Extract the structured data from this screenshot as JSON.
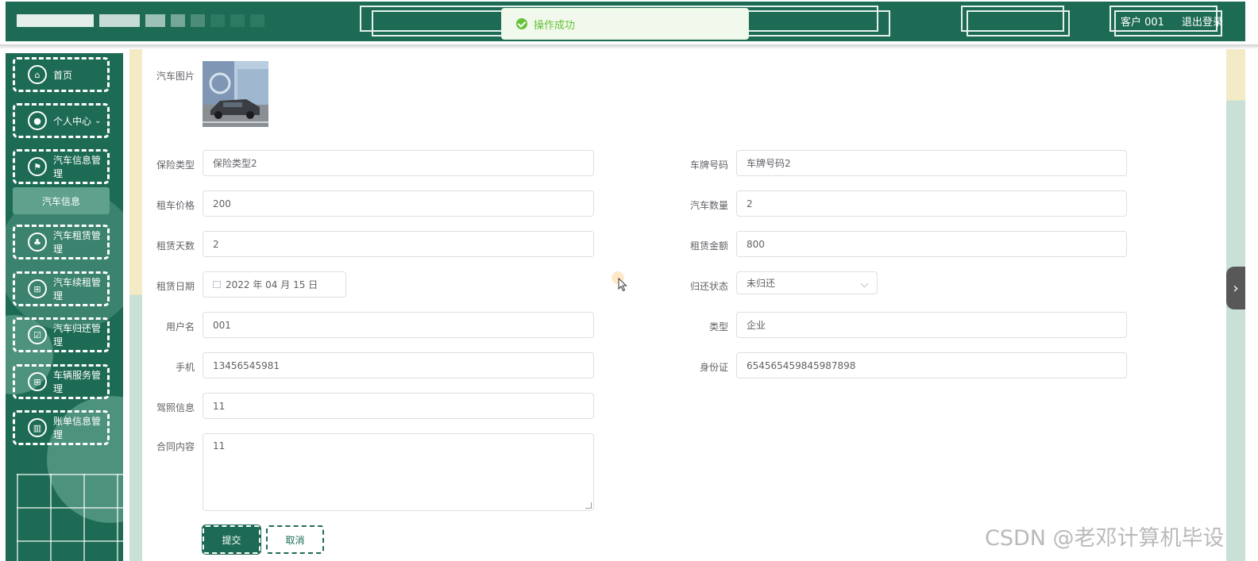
{
  "toast": {
    "message": "操作成功",
    "icon": "success-check-icon"
  },
  "header": {
    "user": "客户  001",
    "logout": "退出登录"
  },
  "sidebar": {
    "items": [
      {
        "label": "首页",
        "icon": "home-icon"
      },
      {
        "label": "个人中心",
        "icon": "user-icon",
        "chevron": "chevron-down-icon"
      },
      {
        "label": "汽车信息管理",
        "icon": "flag-icon"
      },
      {
        "label": "汽车租赁管理",
        "icon": "rental-icon"
      },
      {
        "label": "汽车续租管理",
        "icon": "grid-icon"
      },
      {
        "label": "汽车归还管理",
        "icon": "return-icon"
      },
      {
        "label": "车辆服务管理",
        "icon": "service-icon"
      },
      {
        "label": "账单信息管理",
        "icon": "chart-icon"
      }
    ],
    "submenu": {
      "label": "汽车信息"
    }
  },
  "form": {
    "image_label": "汽车图片",
    "insurance_type": {
      "label": "保险类型",
      "value": "保险类型2"
    },
    "plate_number": {
      "label": "车牌号码",
      "value": "车牌号码2"
    },
    "rental_price": {
      "label": "租车价格",
      "value": "200"
    },
    "car_count": {
      "label": "汽车数量",
      "value": "2"
    },
    "rental_days": {
      "label": "租赁天数",
      "value": "2"
    },
    "rental_amount": {
      "label": "租赁金额",
      "value": "800"
    },
    "rental_date": {
      "label": "租赁日期",
      "value": "2022 年 04 月 15 日"
    },
    "return_status": {
      "label": "归还状态",
      "value": "未归还"
    },
    "username": {
      "label": "用户名",
      "value": "001"
    },
    "type": {
      "label": "类型",
      "value": "企业"
    },
    "phone": {
      "label": "手机",
      "value": "13456545981"
    },
    "id_card": {
      "label": "身份证",
      "value": "654565459845987898"
    },
    "license": {
      "label": "驾照信息",
      "value": "11"
    },
    "contract": {
      "label": "合同内容",
      "value": "11"
    },
    "submit": "提交",
    "cancel": "取消"
  },
  "watermark": "CSDN @老邓计算机毕设",
  "colors": {
    "primary": "#1d6b55",
    "toast_green": "#67c23a",
    "submenu": "#5fa18d"
  }
}
